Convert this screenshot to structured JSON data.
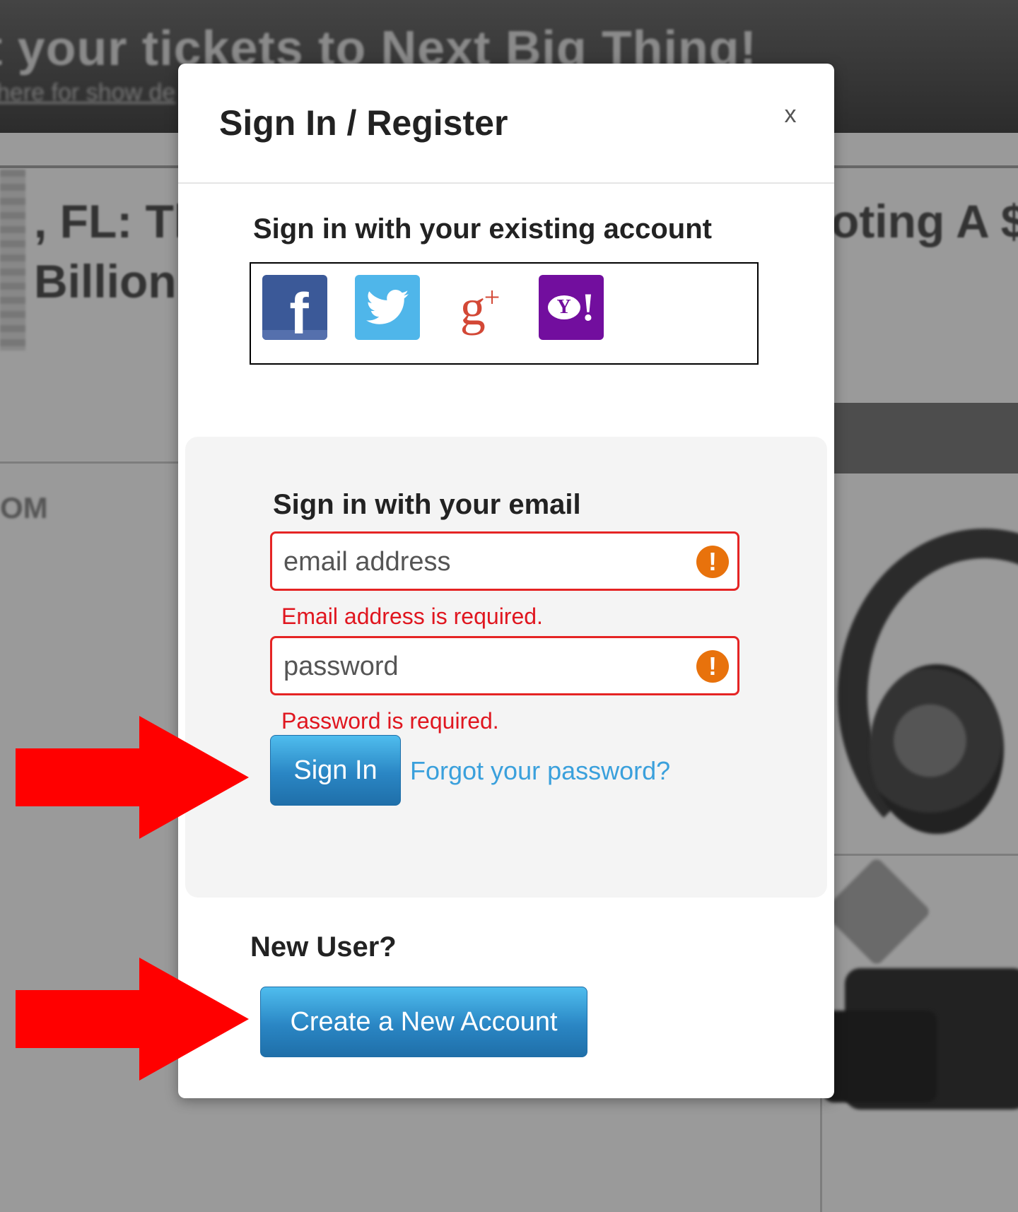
{
  "background": {
    "banner_title": "t your tickets to Next Big Thing!",
    "banner_subtitle": "here for show de",
    "headline_left_1": ", FL: Th",
    "headline_left_2": "Billion",
    "headline_right": "oting A $",
    "sidebar_text": "OM"
  },
  "modal": {
    "title": "Sign In / Register",
    "close_label": "x",
    "social": {
      "heading": "Sign in with your existing account",
      "providers": [
        {
          "name": "facebook",
          "icon": "facebook-icon",
          "color": "#3b5998"
        },
        {
          "name": "twitter",
          "icon": "twitter-icon",
          "color": "#4fb6ea"
        },
        {
          "name": "google-plus",
          "icon": "google-plus-icon",
          "color": "#d34836"
        },
        {
          "name": "yahoo",
          "icon": "yahoo-icon",
          "color": "#720e9e"
        }
      ]
    },
    "email_signin": {
      "heading": "Sign in with your email",
      "email_placeholder": "email address",
      "email_value": "",
      "email_error": "Email address is required.",
      "password_placeholder": "password",
      "password_value": "",
      "password_error": "Password is required.",
      "signin_label": "Sign In",
      "forgot_label": "Forgot your password?"
    },
    "new_user": {
      "heading": "New User?",
      "create_label": "Create a New Account"
    }
  },
  "annotations": {
    "arrow_color": "#ff0000",
    "targets": [
      "sign-in-button",
      "create-account-button"
    ]
  }
}
